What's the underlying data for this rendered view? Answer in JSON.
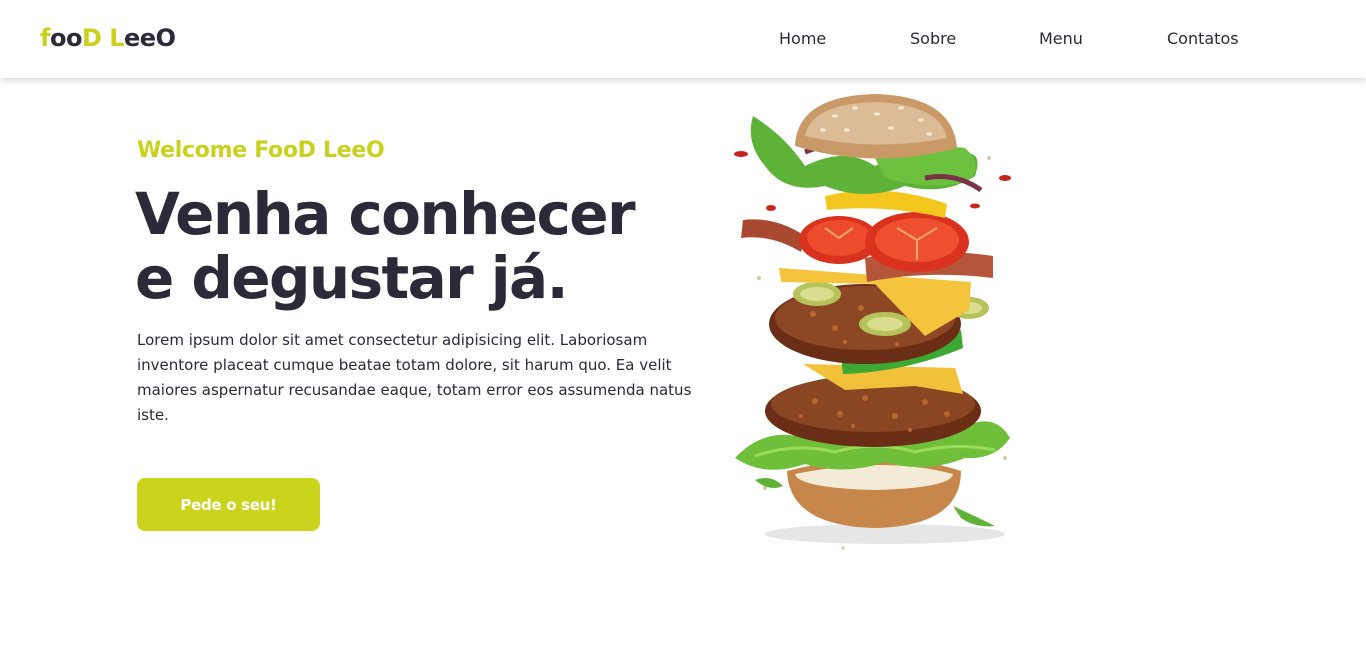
{
  "header": {
    "logo": {
      "part1_accent": "f",
      "part2": "oo",
      "part3_accent": "D",
      "part4": " ",
      "part5_accent": "L",
      "part6": "eeO"
    },
    "nav": [
      "Home",
      "Sobre",
      "Menu",
      "Contatos"
    ]
  },
  "hero": {
    "subtitle": "Welcome FooD LeeO",
    "title_line1": "Venha conhecer",
    "title_line2": "e degustar já.",
    "description": "Lorem ipsum dolor sit amet consectetur adipisicing elit. Laboriosam inventore placeat cumque beatae totam dolore, sit harum quo. Ea velit maiores aspernatur recusandae eaque, totam error eos assumenda natus iste.",
    "cta_label": "Pede o seu!",
    "image": "burger-image"
  },
  "colors": {
    "accent": "#cbd31d",
    "text": "#2b2a38",
    "background": "#ffffff"
  }
}
